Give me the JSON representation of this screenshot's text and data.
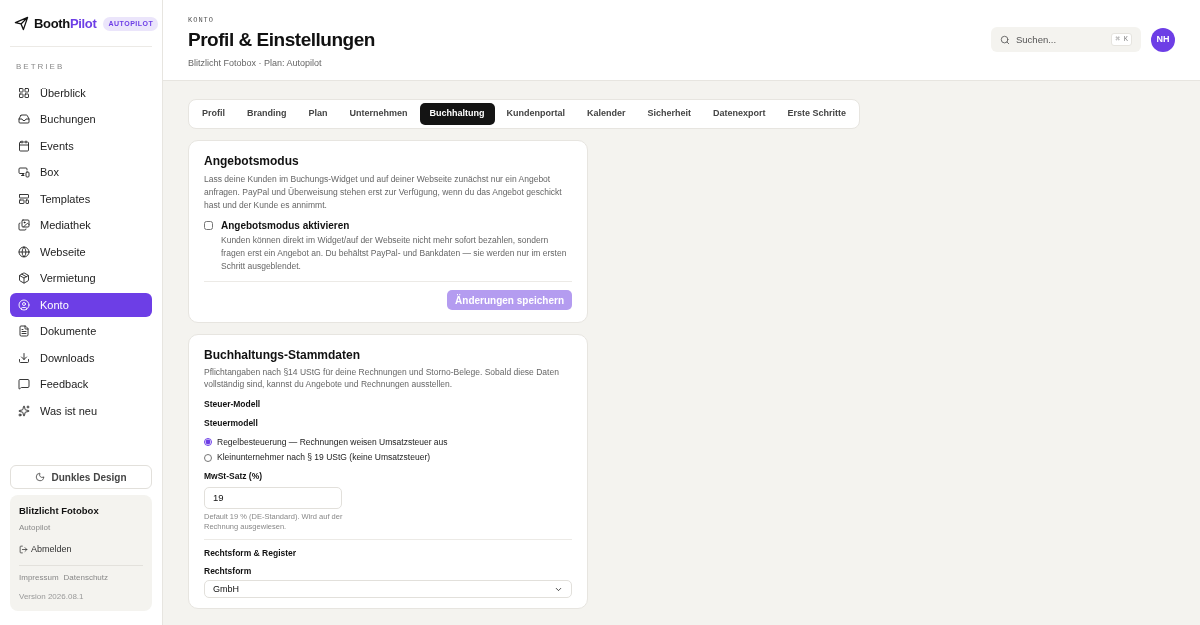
{
  "sidebar": {
    "logo": {
      "brand_main": "Booth",
      "brand_accent": "Pilot",
      "badge": "AUTOPILOT"
    },
    "section": "BETRIEB",
    "items": [
      {
        "label": "Überblick",
        "selected": false
      },
      {
        "label": "Buchungen",
        "selected": false
      },
      {
        "label": "Events",
        "selected": false
      },
      {
        "label": "Box",
        "selected": false
      },
      {
        "label": "Templates",
        "selected": false
      },
      {
        "label": "Mediathek",
        "selected": false
      },
      {
        "label": "Webseite",
        "selected": false
      },
      {
        "label": "Vermietung",
        "selected": false
      },
      {
        "label": "Konto",
        "selected": true
      },
      {
        "label": "Dokumente",
        "selected": false
      },
      {
        "label": "Downloads",
        "selected": false
      },
      {
        "label": "Feedback",
        "selected": false
      },
      {
        "label": "Was ist neu",
        "selected": false
      }
    ],
    "theme_button": "Dunkles Design",
    "account": {
      "name": "Blitzlicht Fotobox",
      "plan": "Autopilot",
      "logout": "Abmelden",
      "links": [
        "Impressum",
        "Datenschutz"
      ],
      "version": "Version 2026.08.1"
    }
  },
  "header": {
    "eyebrow": "KONTO",
    "title": "Profil & Einstellungen",
    "subtitle": "Blitzlicht Fotobox · Plan: Autopilot",
    "search": {
      "placeholder": "Suchen...",
      "shortcut": "⌘ K"
    },
    "avatar": "NH"
  },
  "tabs": [
    {
      "label": "Profil",
      "selected": false
    },
    {
      "label": "Branding",
      "selected": false
    },
    {
      "label": "Plan",
      "selected": false
    },
    {
      "label": "Unternehmen",
      "selected": false
    },
    {
      "label": "Buchhaltung",
      "selected": true
    },
    {
      "label": "Kundenportal",
      "selected": false
    },
    {
      "label": "Kalender",
      "selected": false
    },
    {
      "label": "Sicherheit",
      "selected": false
    },
    {
      "label": "Datenexport",
      "selected": false
    },
    {
      "label": "Erste Schritte",
      "selected": false
    }
  ],
  "quote_card": {
    "title": "Angebotsmodus",
    "description": "Lass deine Kunden im Buchungs-Widget und auf deiner Webseite zunächst nur ein Angebot anfragen. PayPal und Überweisung stehen erst zur Verfügung, wenn du das Angebot geschickt hast und der Kunde es annimmt.",
    "option": {
      "label": "Angebotsmodus aktivieren",
      "checked": false,
      "help": "Kunden können direkt im Widget/auf der Webseite nicht mehr sofort bezahlen, sondern fragen erst ein Angebot an. Du behältst PayPal- und Bankdaten — sie werden nur im ersten Schritt ausgeblendet."
    },
    "save_button": {
      "label": "Änderungen speichern",
      "disabled": true
    }
  },
  "accounting_card": {
    "title": "Buchhaltungs-Stammdaten",
    "description": "Pflichtangaben nach §14 UStG für deine Rechnungen und Storno-Belege. Sobald diese Daten vollständig sind, kannst du Angebote und Rechnungen ausstellen.",
    "tax_section": "Steuer-Modell",
    "tax_label": "Steuermodell",
    "tax_options": [
      {
        "label": "Regelbesteuerung — Rechnungen weisen Umsatzsteuer aus",
        "selected": true
      },
      {
        "label": "Kleinunternehmer nach § 19 UStG (keine Umsatzsteuer)",
        "selected": false
      }
    ],
    "vat": {
      "label": "MwSt-Satz (%)",
      "value": "19",
      "help": "Default 19 % (DE-Standard). Wird auf der Rechnung ausgewiesen."
    },
    "legal_section": "Rechtsform & Register",
    "legal_form": {
      "label": "Rechtsform",
      "value": "GmbH"
    }
  }
}
